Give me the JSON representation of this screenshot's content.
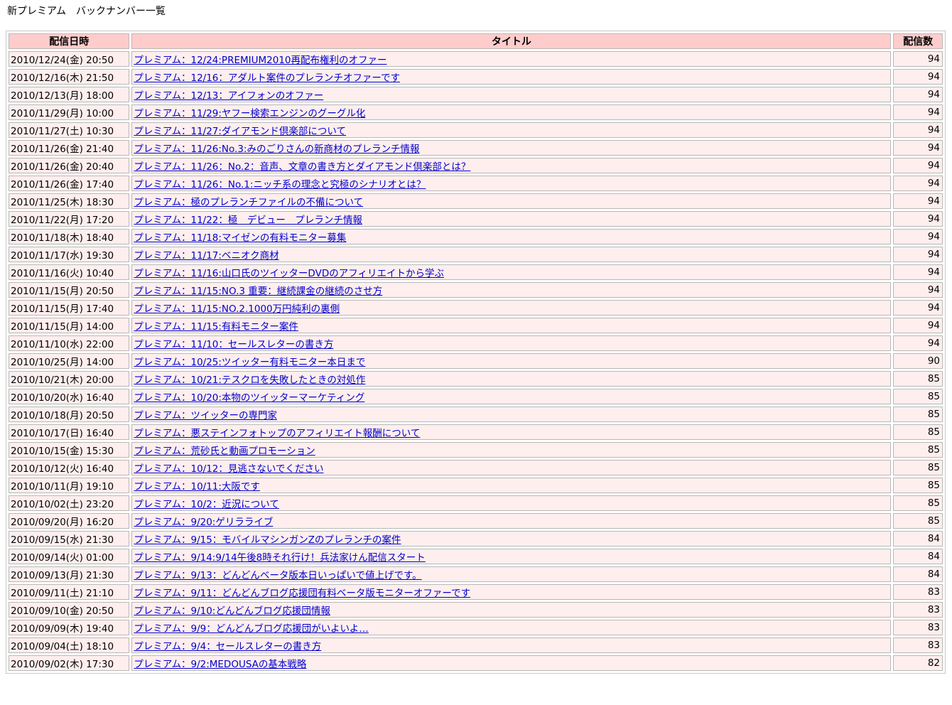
{
  "page": {
    "title": "新プレミアム　バックナンバー一覧"
  },
  "table": {
    "headers": {
      "date": "配信日時",
      "title": "タイトル",
      "count": "配信数"
    },
    "rows": [
      {
        "date": "2010/12/24(金) 20:50",
        "title": "プレミアム：12/24:PREMIUM2010再配布権利のオファー",
        "count": "94"
      },
      {
        "date": "2010/12/16(木) 21:50",
        "title": "プレミアム：12/16：アダルト案件のプレランチオファーです",
        "count": "94"
      },
      {
        "date": "2010/12/13(月) 18:00",
        "title": "プレミアム：12/13：アイフォンのオファー",
        "count": "94"
      },
      {
        "date": "2010/11/29(月) 10:00",
        "title": "プレミアム：11/29:ヤフー検索エンジンのグーグル化",
        "count": "94"
      },
      {
        "date": "2010/11/27(土) 10:30",
        "title": "プレミアム：11/27:ダイアモンド倶楽部について",
        "count": "94"
      },
      {
        "date": "2010/11/26(金) 21:40",
        "title": "プレミアム：11/26:No.3:みのごりさんの新商材のプレランチ情報",
        "count": "94"
      },
      {
        "date": "2010/11/26(金) 20:40",
        "title": "プレミアム：11/26：No.2：音声、文章の書き方とダイアモンド倶楽部とは？",
        "count": "94"
      },
      {
        "date": "2010/11/26(金) 17:40",
        "title": "プレミアム：11/26：No.1:ニッチ系の理念と究極のシナリオとは？",
        "count": "94"
      },
      {
        "date": "2010/11/25(木) 18:30",
        "title": "プレミアム：極のプレランチファイルの不備について",
        "count": "94"
      },
      {
        "date": "2010/11/22(月) 17:20",
        "title": "プレミアム：11/22：極　デビュー　プレランチ情報",
        "count": "94"
      },
      {
        "date": "2010/11/18(木) 18:40",
        "title": "プレミアム：11/18:マイゼンの有料モニター募集",
        "count": "94"
      },
      {
        "date": "2010/11/17(水) 19:30",
        "title": "プレミアム：11/17:ベニオク商材",
        "count": "94"
      },
      {
        "date": "2010/11/16(火) 10:40",
        "title": "プレミアム：11/16:山口氏のツイッターDVDのアフィリエイトから学ぶ",
        "count": "94"
      },
      {
        "date": "2010/11/15(月) 20:50",
        "title": "プレミアム：11/15:NO.3 重要：継続課金の継続のさせ方",
        "count": "94"
      },
      {
        "date": "2010/11/15(月) 17:40",
        "title": "プレミアム：11/15:NO.2.1000万円純利の裏側",
        "count": "94"
      },
      {
        "date": "2010/11/15(月) 14:00",
        "title": "プレミアム：11/15:有料モニター案件",
        "count": "94"
      },
      {
        "date": "2010/11/10(水) 22:00",
        "title": "プレミアム：11/10：セールスレターの書き方",
        "count": "94"
      },
      {
        "date": "2010/10/25(月) 14:00",
        "title": "プレミアム：10/25:ツイッター有料モニター本日まで",
        "count": "90"
      },
      {
        "date": "2010/10/21(木) 20:00",
        "title": "プレミアム：10/21:テスクロを失敗したときの対処作",
        "count": "85"
      },
      {
        "date": "2010/10/20(水) 16:40",
        "title": "プレミアム：10/20:本物のツイッターマーケティング",
        "count": "85"
      },
      {
        "date": "2010/10/18(月) 20:50",
        "title": "プレミアム：ツイッターの専門家",
        "count": "85"
      },
      {
        "date": "2010/10/17(日) 16:40",
        "title": "プレミアム：悪ステインフォトップのアフィリエイト報酬について",
        "count": "85"
      },
      {
        "date": "2010/10/15(金) 15:30",
        "title": "プレミアム：荒砂氏と動画プロモーション",
        "count": "85"
      },
      {
        "date": "2010/10/12(火) 16:40",
        "title": "プレミアム：10/12：見逃さないでください",
        "count": "85"
      },
      {
        "date": "2010/10/11(月) 19:10",
        "title": "プレミアム：10/11:大阪です",
        "count": "85"
      },
      {
        "date": "2010/10/02(土) 23:20",
        "title": "プレミアム：10/2：近況について",
        "count": "85"
      },
      {
        "date": "2010/09/20(月) 16:20",
        "title": "プレミアム：9/20:ゲリラライブ",
        "count": "85"
      },
      {
        "date": "2010/09/15(水) 21:30",
        "title": "プレミアム：9/15：モバイルマシンガンZのプレランチの案件",
        "count": "84"
      },
      {
        "date": "2010/09/14(火) 01:00",
        "title": "プレミアム：9/14:9/14午後8時それ行け！兵法家けん配信スタート",
        "count": "84"
      },
      {
        "date": "2010/09/13(月) 21:30",
        "title": "プレミアム：9/13：どんどんベータ版本日いっぱいで値上げです。",
        "count": "84"
      },
      {
        "date": "2010/09/11(土) 21:10",
        "title": "プレミアム：9/11：どんどんブログ応援団有料ベータ版モニターオファーです",
        "count": "83"
      },
      {
        "date": "2010/09/10(金) 20:50",
        "title": "プレミアム：9/10:どんどんブログ応援団情報",
        "count": "83"
      },
      {
        "date": "2010/09/09(木) 19:40",
        "title": "プレミアム：9/9：どんどんブログ応援団がいよいよ…",
        "count": "83"
      },
      {
        "date": "2010/09/04(土) 18:10",
        "title": "プレミアム：9/4：セールスレターの書き方",
        "count": "83"
      },
      {
        "date": "2010/09/02(木) 17:30",
        "title": "プレミアム：9/2:MEDOUSAの基本戦略",
        "count": "82"
      }
    ]
  },
  "colors": {
    "header_bg": "#ffcccc",
    "row_bg": "#ffeeee",
    "link": "#0000cc"
  }
}
